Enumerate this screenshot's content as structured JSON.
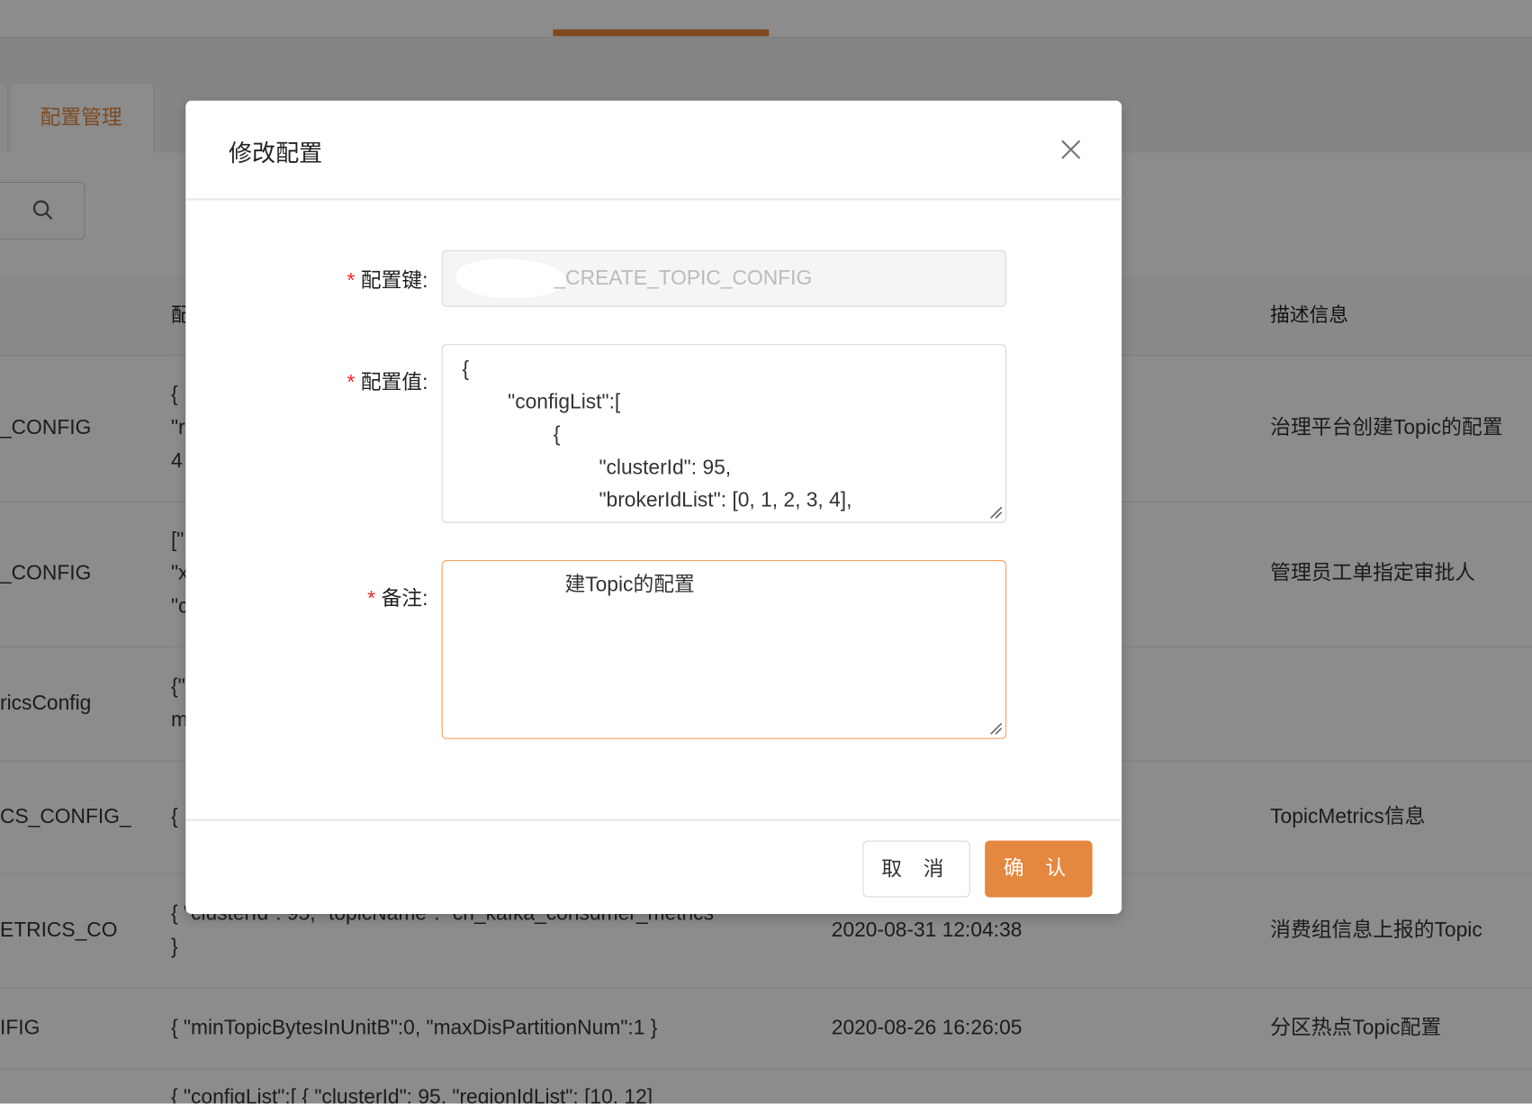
{
  "page": {
    "tab_label": "配置管理"
  },
  "table": {
    "headers": [
      "配",
      "描述信息"
    ],
    "rows": [
      {
        "key": "_CONFIG",
        "value": "{\n\"r\n4",
        "time": "",
        "desc": "治理平台创建Topic的配置"
      },
      {
        "key": "_CONFIG",
        "value": "[\"\n\"x\n\"c",
        "time": "",
        "desc": "管理员工单指定审批人"
      },
      {
        "key": "ricsConfig",
        "value": "{\"\nm",
        "time": "",
        "desc": ""
      },
      {
        "key": "CS_CONFIG_",
        "value": "{",
        "time": "",
        "desc": "TopicMetrics信息"
      },
      {
        "key": "ETRICS_CO",
        "value": "{ \"clusterId\": 95, \"topicName\": \"cn_kafka_consumer_metrics\"\n}",
        "time": "2020-08-31 12:04:38",
        "desc": "消费组信息上报的Topic"
      },
      {
        "key": "IFIG",
        "value": "{ \"minTopicBytesInUnitB\":0, \"maxDisPartitionNum\":1 }",
        "time": "2020-08-26 16:26:05",
        "desc": "分区热点Topic配置"
      },
      {
        "key": "",
        "value": "{ \"configList\":[ { \"clusterId\": 95, \"regionIdList\": [10, 12]",
        "time": "",
        "desc": ""
      }
    ]
  },
  "modal": {
    "title": "修改配置",
    "fields": {
      "key_label": "配置键:",
      "key_value": "_CREATE_TOPIC_CONFIG",
      "value_label": "配置值:",
      "value_text": "{\n        \"configList\":[\n                {\n                        \"clusterId\": 95,\n                        \"brokerIdList\": [0, 1, 2, 3, 4],",
      "note_label": "备注:",
      "note_text": "                  建Topic的配置"
    },
    "cancel_label": "取 消",
    "ok_label": "确 认"
  },
  "colors": {
    "accent": "#e4873f",
    "required": "#f5222d"
  }
}
